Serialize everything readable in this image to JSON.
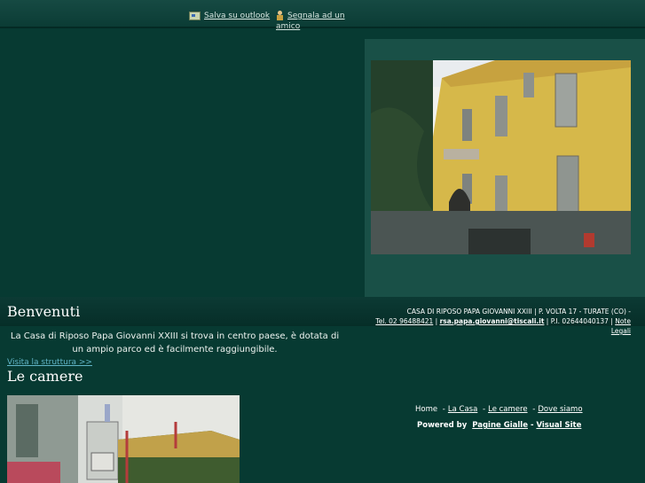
{
  "header": {
    "save_outlook": "Salva su outlook",
    "recommend_friend_line1": "Segnala ad un",
    "recommend_friend_line2": "amico"
  },
  "welcome": {
    "title": "Benvenuti",
    "text": "La Casa di Riposo Papa Giovanni XXIII si trova in centro paese, è dotata di un ampio parco ed è facilmente raggiungibile.",
    "visit_link": "Visita la struttura >>"
  },
  "rooms": {
    "title": "Le camere"
  },
  "footer": {
    "line1": "CASA DI RIPOSO PAPA GIOVANNI XXIII | P. VOLTA 17 - TURATE (CO) -",
    "phone": "Tel. 02 96488421",
    "email": "rsa.papa.giovanni@tiscali.it",
    "vat": "P.I. 02644040137",
    "legal": "Note Legali",
    "nav": [
      "Home",
      "La Casa",
      "Le camere",
      "Dove siamo"
    ],
    "powered_label": "Powered by",
    "powered_link1": "Pagine Gialle",
    "powered_sep": "-",
    "powered_link2": "Visual Site"
  },
  "colors": {
    "background": "#073a32",
    "panel": "#195047",
    "link": "#61b5c7"
  },
  "icons": [
    "outlook-icon",
    "friend-icon"
  ]
}
